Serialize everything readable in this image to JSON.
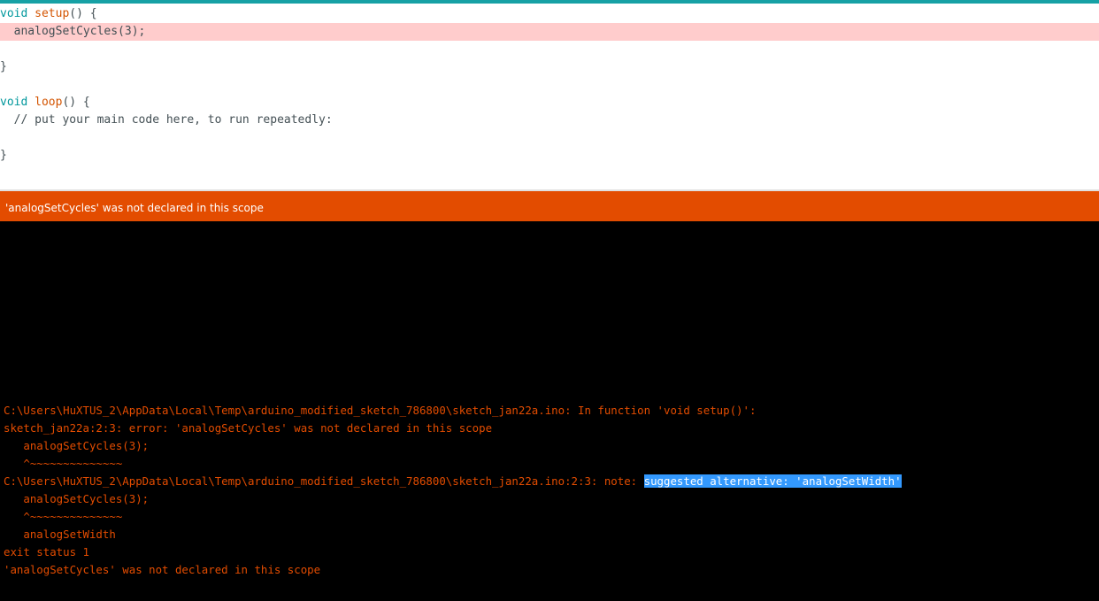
{
  "editor": {
    "lines": [
      {
        "type": "void",
        "name": "setup",
        "rest": "() {"
      },
      {
        "indent": "  ",
        "text": "analogSetCycles(3);"
      },
      {
        "text": "}"
      },
      {
        "type": "void",
        "name": "loop",
        "rest": "() {"
      },
      {
        "indent": "  ",
        "text": "// put your main code here, to run repeatedly:"
      },
      {
        "text": "}"
      }
    ]
  },
  "status_bar": {
    "message": "'analogSetCycles' was not declared in this scope"
  },
  "console": {
    "lines": [
      "C:\\Users\\HuXTUS_2\\AppData\\Local\\Temp\\arduino_modified_sketch_786800\\sketch_jan22a.ino: In function 'void setup()':",
      "sketch_jan22a:2:3: error: 'analogSetCycles' was not declared in this scope",
      "   analogSetCycles(3);",
      "   ^~~~~~~~~~~~~~~",
      "C:\\Users\\HuXTUS_2\\AppData\\Local\\Temp\\arduino_modified_sketch_786800\\sketch_jan22a.ino:2:3: note: ",
      "suggested alternative: 'analogSetWidth'",
      "   analogSetCycles(3);",
      "   ^~~~~~~~~~~~~~~",
      "   analogSetWidth",
      "exit status 1",
      "'analogSetCycles' was not declared in this scope"
    ]
  },
  "colors": {
    "accent": "#17A1A5",
    "status_bar": "#E34C00",
    "error_text": "#E34C00",
    "error_line_highlight": "#FFCCCC",
    "selection": "#3399FF"
  }
}
